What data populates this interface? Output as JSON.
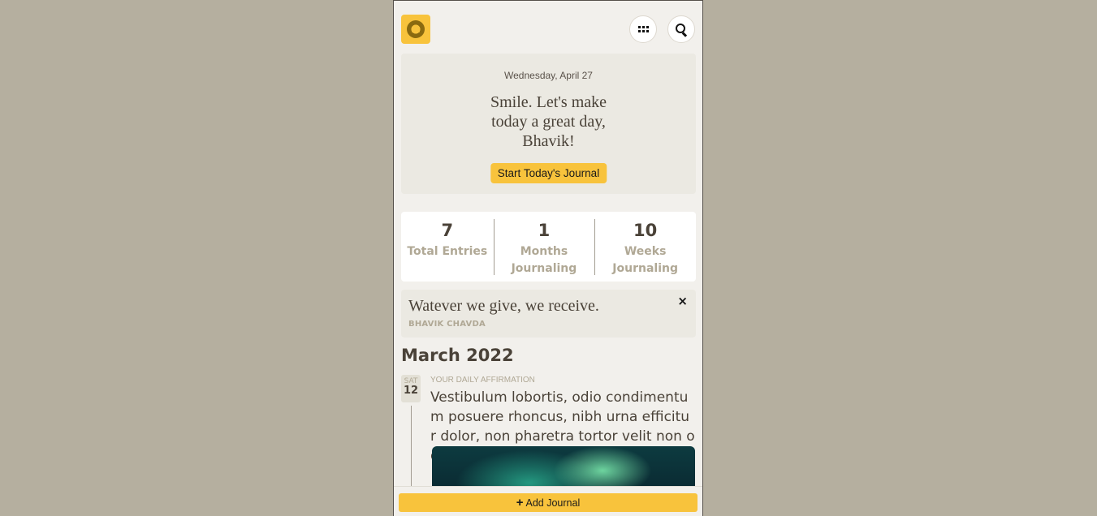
{
  "header": {
    "logo_icon": "sun-triangle-logo-icon",
    "apps_icon": "grid-icon",
    "search_icon": "search-icon"
  },
  "greeting": {
    "date": "Wednesday, April 27",
    "message": "Smile. Let's make today a great day, Bhavik!",
    "cta": "Start Today's Journal"
  },
  "stats": [
    {
      "value": "7",
      "label": "Total Entries"
    },
    {
      "value": "1",
      "label": "Months Journaling"
    },
    {
      "value": "10",
      "label": "Weeks Journaling"
    }
  ],
  "quote": {
    "text": "Watever we give, we receive.",
    "author": "BHAVIK CHAVDA",
    "close": "×"
  },
  "timeline": {
    "month": "March 2022",
    "entries": [
      {
        "dow": "SAT",
        "day": "12",
        "kind": "YOUR DAILY AFFIRMATION",
        "body": "Vestibulum lobortis, odio condimentum posuere rhoncus, nibh urna efficitur dolor, non pharetra tortor velit non odio."
      }
    ]
  },
  "footer": {
    "add_label": "Add Journal",
    "plus": "+"
  },
  "colors": {
    "accent": "#f8c33c",
    "background": "#b5af9f",
    "card": "#ebe9e2"
  }
}
